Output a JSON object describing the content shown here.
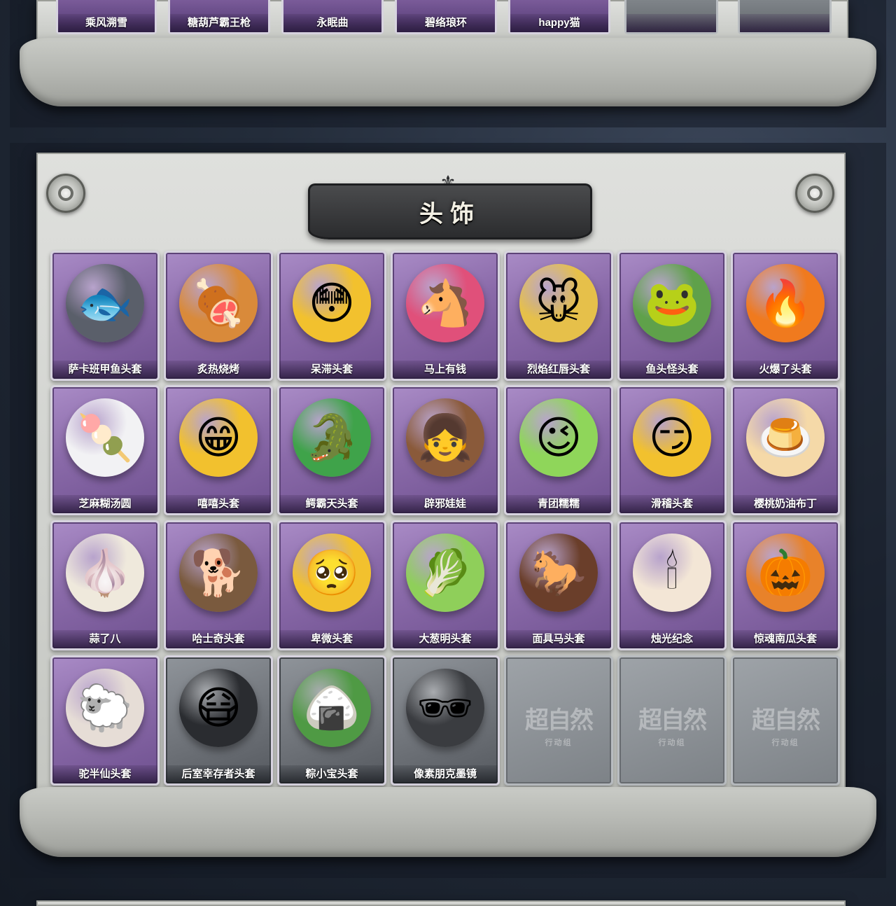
{
  "top_strip": {
    "items": [
      {
        "label": "乘风溯雪"
      },
      {
        "label": "糖葫芦霸王枪"
      },
      {
        "label": "永眠曲"
      },
      {
        "label": "碧络琅环"
      },
      {
        "label": "happy猫"
      },
      {
        "label": ""
      },
      {
        "label": ""
      }
    ]
  },
  "section": {
    "title": "头饰"
  },
  "cards": [
    {
      "label": "萨卡班甲鱼头套",
      "icon": "fish-head-icon",
      "glyph": "🐟",
      "color": "#5a5f6a",
      "grey": false
    },
    {
      "label": "炙热烧烤",
      "icon": "bbq-meat-icon",
      "glyph": "🍖",
      "color": "#d98a3a",
      "grey": false
    },
    {
      "label": "呆滞头套",
      "icon": "stunned-face-icon",
      "glyph": "😳",
      "color": "#f2c12e",
      "grey": false
    },
    {
      "label": "马上有钱",
      "icon": "pink-horse-icon",
      "glyph": "🐴",
      "color": "#e0507a",
      "grey": false
    },
    {
      "label": "烈焰红唇头套",
      "icon": "yellow-mouse-icon",
      "glyph": "🐭",
      "color": "#e6c04a",
      "grey": false
    },
    {
      "label": "鱼头怪头套",
      "icon": "green-fish-icon",
      "glyph": "🐸",
      "color": "#5fa14a",
      "grey": false
    },
    {
      "label": "火爆了头套",
      "icon": "fireball-icon",
      "glyph": "🔥",
      "color": "#f07a1e",
      "grey": false
    },
    {
      "label": "芝麻糊汤圆",
      "icon": "rice-ball-icon",
      "glyph": "🍡",
      "color": "#f2f2f4",
      "grey": false
    },
    {
      "label": "嘻嘻头套",
      "icon": "grin-face-icon",
      "glyph": "😁",
      "color": "#f2c12e",
      "grey": false
    },
    {
      "label": "鳄霸天头套",
      "icon": "crocodile-icon",
      "glyph": "🐊",
      "color": "#3fa34a",
      "grey": false
    },
    {
      "label": "辟邪娃娃",
      "icon": "doll-head-icon",
      "glyph": "👧",
      "color": "#8a5a3a",
      "grey": false
    },
    {
      "label": "青团糯糯",
      "icon": "green-dumpling-icon",
      "glyph": "😉",
      "color": "#8fd65a",
      "grey": false
    },
    {
      "label": "滑稽头套",
      "icon": "smirk-face-icon",
      "glyph": "😏",
      "color": "#f2c12e",
      "grey": false
    },
    {
      "label": "樱桃奶油布丁",
      "icon": "pudding-icon",
      "glyph": "🍮",
      "color": "#f5d9a8",
      "grey": false
    },
    {
      "label": "蒜了八",
      "icon": "garlic-icon",
      "glyph": "🧄",
      "color": "#efe9dc",
      "grey": false
    },
    {
      "label": "哈士奇头套",
      "icon": "husky-icon",
      "glyph": "🐕",
      "color": "#7a5a3e",
      "grey": false
    },
    {
      "label": "卑微头套",
      "icon": "sad-face-icon",
      "glyph": "🥺",
      "color": "#f2c12e",
      "grey": false
    },
    {
      "label": "大葱明头套",
      "icon": "scallion-icon",
      "glyph": "🥬",
      "color": "#8fcf5a",
      "grey": false
    },
    {
      "label": "面具马头套",
      "icon": "horse-mask-icon",
      "glyph": "🐎",
      "color": "#6a3e2a",
      "grey": false
    },
    {
      "label": "烛光纪念",
      "icon": "candle-icon",
      "glyph": "🕯",
      "color": "#f3e6d6",
      "grey": false
    },
    {
      "label": "惊魂南瓜头套",
      "icon": "pumpkin-icon",
      "glyph": "🎃",
      "color": "#e8822a",
      "grey": false
    },
    {
      "label": "驼半仙头套",
      "icon": "alpaca-icon",
      "glyph": "🐑",
      "color": "#e6ddd6",
      "grey": false
    },
    {
      "label": "后室幸存者头套",
      "icon": "gas-mask-icon",
      "glyph": "😷",
      "color": "#2a2c30",
      "grey": true
    },
    {
      "label": "粽小宝头套",
      "icon": "zongzi-icon",
      "glyph": "🍙",
      "color": "#4f9a44",
      "grey": true
    },
    {
      "label": "像素朋克墨镜",
      "icon": "pixel-sunglasses-icon",
      "glyph": "🕶",
      "color": "#3a3c40",
      "grey": true
    }
  ],
  "empty_slots": {
    "watermark": "超自然",
    "watermark_sub": "行动组",
    "count": 3
  }
}
